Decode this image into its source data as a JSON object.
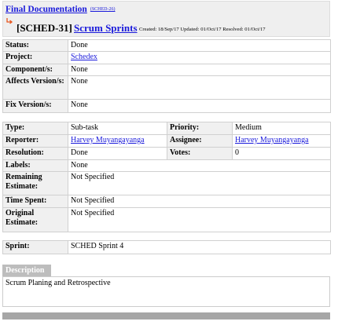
{
  "header": {
    "parent_title": "Final Documentation",
    "parent_key": "(SCHED-26)",
    "issue_key": "[SCHED-31]",
    "issue_summary": "Scrum Sprints",
    "dates": "Created: 18/Sep/17  Updated: 01/Oct/17  Resolved: 01/Oct/17"
  },
  "details": {
    "status_label": "Status:",
    "status": "Done",
    "project_label": "Project:",
    "project": "Schedex",
    "components_label": "Component/s:",
    "components": "None",
    "affects_label": "Affects Version/s:",
    "affects": "None",
    "fix_label": "Fix Version/s:",
    "fix": "None"
  },
  "people": {
    "type_label": "Type:",
    "type": "Sub-task",
    "priority_label": "Priority:",
    "priority": "Medium",
    "reporter_label": "Reporter:",
    "reporter": "Harvey Muyangayanga",
    "assignee_label": "Assignee:",
    "assignee": "Harvey Muyangayanga",
    "resolution_label": "Resolution:",
    "resolution": "Done",
    "votes_label": "Votes:",
    "votes": "0",
    "labels_label": "Labels:",
    "labels": "None",
    "remaining_label": "Remaining Estimate:",
    "remaining": "Not Specified",
    "timespent_label": "Time Spent:",
    "timespent": "Not Specified",
    "original_label": "Original Estimate:",
    "original": "Not Specified"
  },
  "sprint": {
    "label": "Sprint:",
    "value": "SCHED Sprint 4"
  },
  "description": {
    "header": "Description",
    "text": "Scrum Planing and Retrospective"
  },
  "colors": {
    "link": "#1a1adb",
    "icon": "#e8541c",
    "label_bg": "#f0f0f0"
  },
  "icons": {
    "subtask": "subtask-arrow-icon"
  }
}
